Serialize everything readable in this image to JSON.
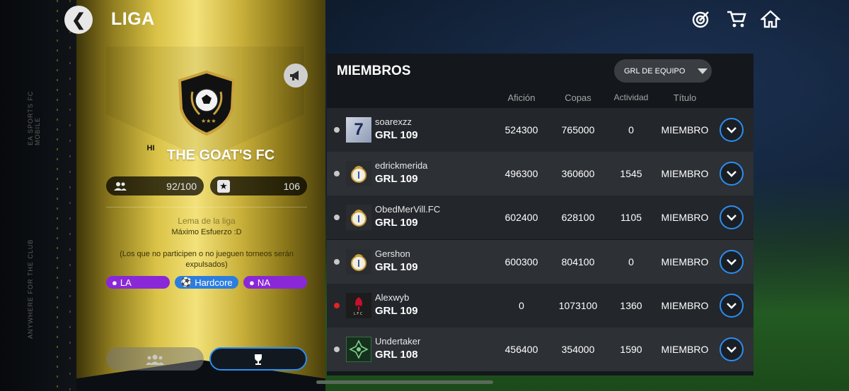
{
  "header": {
    "title": "LIGA",
    "back_icon": "chevron-left-icon"
  },
  "side_text": {
    "top": "EA SPORTS FC MOBILE",
    "bottom": "ANYWHERE FOR THE CLUB"
  },
  "club": {
    "name": "THE GOAT'S FC",
    "logo_text": "HI",
    "members_count": "92/100",
    "trophies": "106",
    "motto_label": "Lema de la liga",
    "motto": "Máximo Esfuerzo :D",
    "description": "(Los que no participen o no jueguen torneos serán expulsados)",
    "tags": [
      {
        "label": "LA",
        "icon": "location-icon",
        "color": "#8a28d8"
      },
      {
        "label": "Hardcore",
        "icon": "ball-icon",
        "color": "#2d7de0"
      },
      {
        "label": "NA",
        "icon": "location-icon",
        "color": "#8a28d8"
      }
    ]
  },
  "members_panel": {
    "title": "MIEMBROS",
    "sort_label": "GRL DE EQUIPO",
    "columns": {
      "aficion": "Afición",
      "copas": "Copas",
      "actividad": "Actividad",
      "titulo": "Título"
    },
    "rows": [
      {
        "name": "soarexzz",
        "rating": "GRL 109",
        "aficion": "524300",
        "copas": "765000",
        "actividad": "0",
        "titulo": "MIEMBRO",
        "status": "online",
        "avatar": "number-7-badge"
      },
      {
        "name": "edrickmerida",
        "rating": "GRL 109",
        "aficion": "496300",
        "copas": "360600",
        "actividad": "1545",
        "titulo": "MIEMBRO",
        "status": "online",
        "avatar": "real-madrid-crest"
      },
      {
        "name": "ObedMerVill.FC",
        "rating": "GRL 109",
        "aficion": "602400",
        "copas": "628100",
        "actividad": "1105",
        "titulo": "MIEMBRO",
        "status": "online",
        "avatar": "real-madrid-crest"
      },
      {
        "name": "Gershon",
        "rating": "GRL 109",
        "aficion": "600300",
        "copas": "804100",
        "actividad": "0",
        "titulo": "MIEMBRO",
        "status": "online",
        "avatar": "real-madrid-crest"
      },
      {
        "name": "Alexwyb",
        "rating": "GRL 109",
        "aficion": "0",
        "copas": "1073100",
        "actividad": "1360",
        "titulo": "MIEMBRO",
        "status": "offline",
        "avatar": "liverpool-crest"
      },
      {
        "name": "Undertaker",
        "rating": "GRL 108",
        "aficion": "456400",
        "copas": "354000",
        "actividad": "1590",
        "titulo": "MIEMBRO",
        "status": "online",
        "avatar": "green-emblem"
      }
    ]
  },
  "colors": {
    "accent_blue": "#2d8ef0",
    "gold": "#d9c246",
    "tag_purple": "#8a28d8",
    "offline_red": "#e02424"
  }
}
